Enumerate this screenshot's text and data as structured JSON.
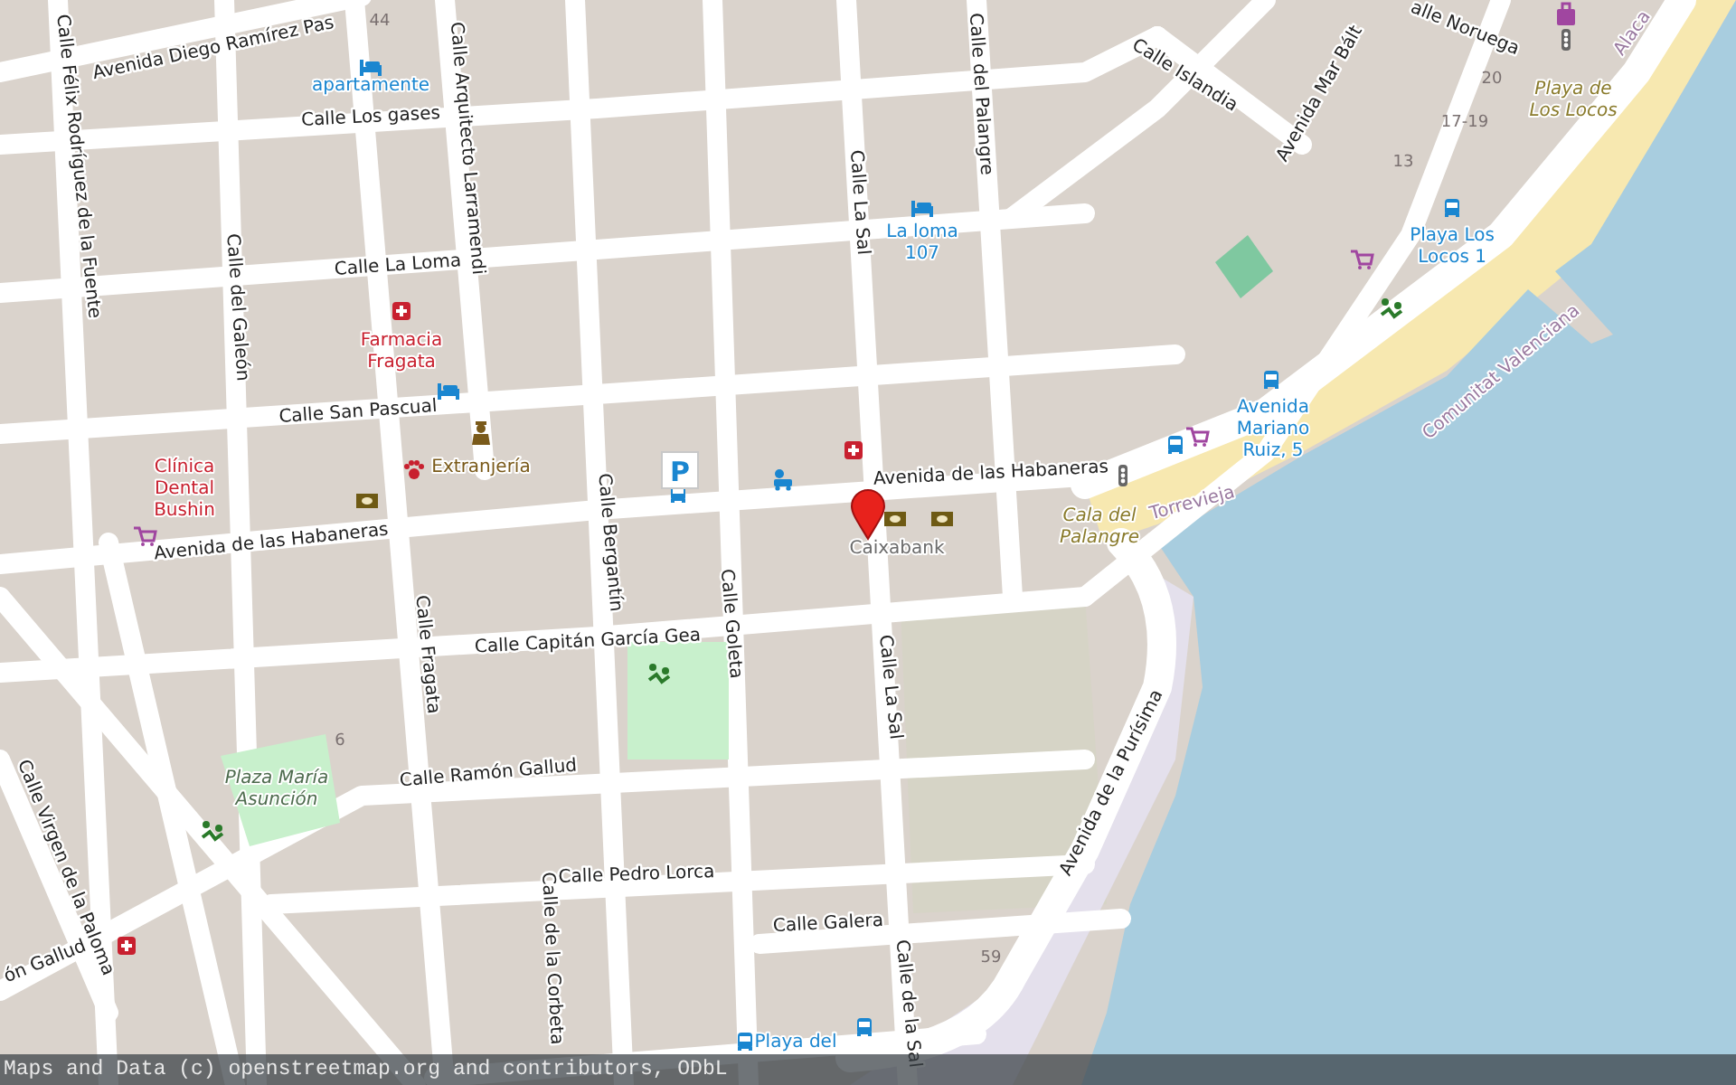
{
  "map": {
    "street_labels": [
      "Avenida Diego Ramírez Pas",
      "Calle Félix Rodríguez de la Fuente",
      "Calle Los gases",
      "Calle Arquitecto Larramendi",
      "Calle La Loma",
      "Calle del Galeón",
      "Calle San Pascual",
      "Calle La Sal",
      "Calle del Palangre",
      "Calle Islandia",
      "Avenida Mar Bált",
      "alle Noruega",
      "Avenida de las Habaneras",
      "Avenida de las Habaneras",
      "Calle Bergantín",
      "Calle Goleta",
      "Calle Capitán García Gea",
      "Calle Fragata",
      "Calle La Sal",
      "Avenida de la Purísima",
      "Calle Ramón Gallud",
      "Calle Virgen de la Paloma",
      "ón Gallud",
      "Calle Pedro Lorca",
      "Calle de la Corbeta",
      "Calle Galera",
      "Calle de la Sal"
    ],
    "place_labels": [
      {
        "lines": [
          "apartamente"
        ],
        "kind": "lodging"
      },
      {
        "lines": [
          "La loma",
          "107"
        ],
        "kind": "lodging"
      },
      {
        "lines": [
          "Farmacia",
          "Fragata"
        ],
        "kind": "health"
      },
      {
        "lines": [
          "Clínica",
          "Dental",
          "Bushin"
        ],
        "kind": "health"
      },
      {
        "lines": [
          "Extranjería"
        ],
        "kind": "government"
      },
      {
        "lines": [
          "Caixabank"
        ],
        "kind": "bank"
      },
      {
        "lines": [
          "Playa Los",
          "Locos 1"
        ],
        "kind": "transit"
      },
      {
        "lines": [
          "Avenida",
          "Mariano",
          "Ruiz, 5"
        ],
        "kind": "transit"
      },
      {
        "lines": [
          "Playa de",
          "Los Locos"
        ],
        "kind": "natural"
      },
      {
        "lines": [
          "Cala del",
          "Palangre"
        ],
        "kind": "natural"
      },
      {
        "lines": [
          "Plaza María",
          "Asunción"
        ],
        "kind": "park"
      },
      {
        "lines": [
          "Torrevieja"
        ],
        "kind": "admin"
      },
      {
        "lines": [
          "Comunitat Valenciana"
        ],
        "kind": "admin"
      },
      {
        "lines": [
          "Alaca"
        ],
        "kind": "admin"
      },
      {
        "lines": [
          "Playa del"
        ],
        "kind": "transit"
      }
    ],
    "house_numbers": [
      "44",
      "20",
      "17-19",
      "13",
      "6",
      "59"
    ],
    "parking_sign": "P"
  },
  "attribution": "Maps and Data (c) openstreetmap.org and contributors, ODbL"
}
